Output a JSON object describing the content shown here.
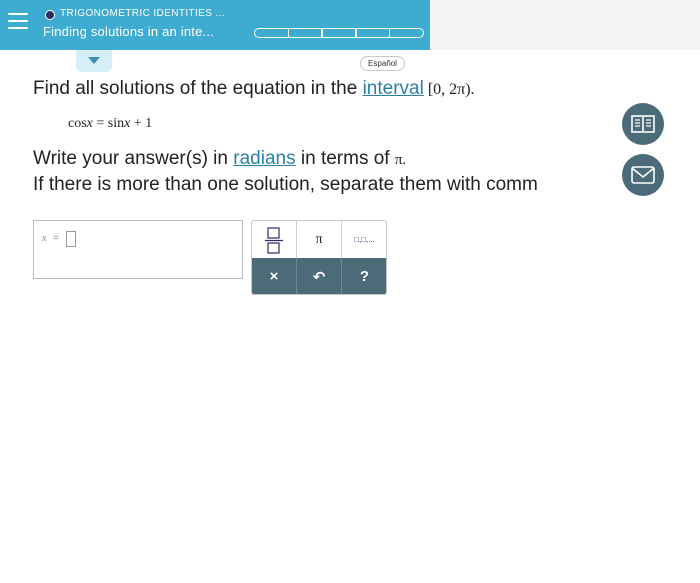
{
  "header": {
    "topic_label": "TRIGONOMETRIC IDENTITIES ...",
    "topic_title": "Finding solutions in an inte...",
    "progress_segments": 5
  },
  "language_button": "Español",
  "question": {
    "line1_prefix": "Find all solutions of the equation in the ",
    "line1_link": "interval",
    "interval": "[0, 2π).",
    "equation": {
      "lhs_fn": "cos",
      "lhs_var": "x",
      "equals": "=",
      "rhs_fn": "sin",
      "rhs_var": "x",
      "rhs_rest": "+ 1"
    },
    "line2_prefix": "Write your answer(s) in ",
    "line2_link": "radians",
    "line2_suffix": " in terms of ",
    "line2_pi": "π.",
    "line3": "If there is more than one solution, separate them with comm"
  },
  "answer": {
    "variable": "x",
    "equals": "="
  },
  "keypad": {
    "pi_label": "π",
    "list_label": "□,□,...",
    "clear_label": "×",
    "undo_label": "↶",
    "help_label": "?"
  },
  "icons": {
    "menu": "hamburger-menu-icon",
    "book": "book-icon",
    "mail": "mail-icon",
    "collapse": "chevron-down-icon"
  },
  "colors": {
    "header_bg": "#3eabd0",
    "link": "#2b7fa5",
    "keypad_dark": "#4b6b78",
    "circle_buttons": "#4b6b78"
  }
}
